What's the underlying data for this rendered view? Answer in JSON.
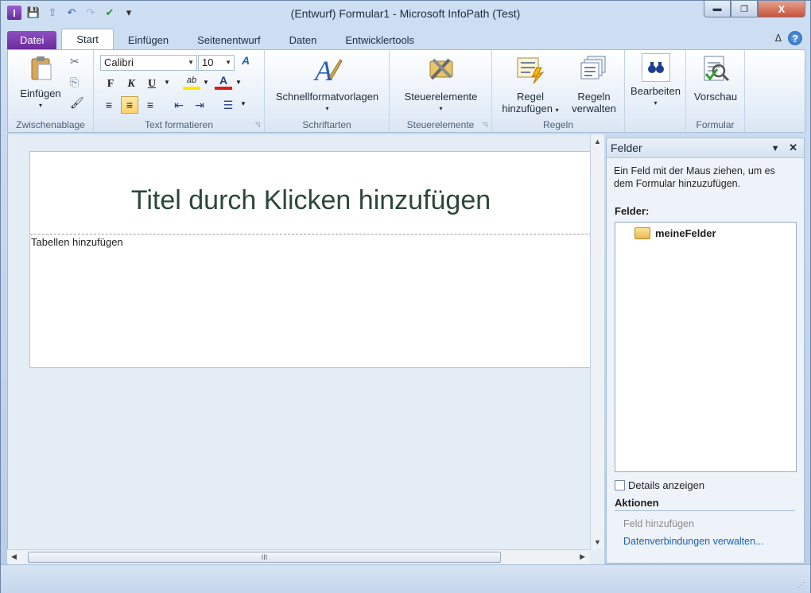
{
  "window": {
    "title": "(Entwurf) Formular1  -  Microsoft InfoPath (Test)",
    "min_glyph": "▬",
    "max_glyph": "❐",
    "close_glyph": "X"
  },
  "qat": {
    "app_glyph": "I",
    "save_glyph": "💾",
    "preview_glyph": "⇧",
    "undo_glyph": "↶",
    "redo_glyph": "↷",
    "check_glyph": "✔",
    "customize_glyph": "▾"
  },
  "tabs": {
    "file": "Datei",
    "start": "Start",
    "insert": "Einfügen",
    "page_design": "Seitenentwurf",
    "data": "Daten",
    "developer": "Entwicklertools",
    "collapse_glyph": "ᐃ",
    "help_glyph": "?"
  },
  "ribbon": {
    "clipboard": {
      "group_label": "Zwischenablage",
      "paste_label": "Einfügen",
      "cut_glyph": "✂",
      "copy_glyph": "⎘",
      "painter_glyph": "🖌"
    },
    "font": {
      "group_label": "Text formatieren",
      "font_name": "Calibri",
      "font_size": "10",
      "clear_glyph": "A",
      "bold": "F",
      "italic": "K",
      "underline": "U",
      "highlight_glyph": "ab",
      "font_color_glyph": "A",
      "align_left_glyph": "≡",
      "align_center_glyph": "≡",
      "align_right_glyph": "≡",
      "outdent_glyph": "⇤",
      "indent_glyph": "⇥",
      "bullets_glyph": "☰"
    },
    "styles": {
      "group_label": "Schriftarten",
      "quickstyles_label": "Schnellformatvorlagen"
    },
    "controls": {
      "group_label": "Steuerelemente",
      "controls_label": "Steuerelemente"
    },
    "rules": {
      "group_label": "Regeln",
      "add_rule_line1": "Regel",
      "add_rule_line2": "hinzufügen",
      "manage_rules_line1": "Regeln",
      "manage_rules_line2": "verwalten"
    },
    "editing": {
      "edit_label": "Bearbeiten"
    },
    "form": {
      "group_label": "Formular",
      "preview_label": "Vorschau"
    }
  },
  "form": {
    "title_placeholder": "Titel durch Klicken hinzufügen",
    "table_hint": "Tabellen hinzufügen"
  },
  "scroll": {
    "thumb_glyph": "III"
  },
  "taskpane": {
    "title": "Felder",
    "menu_glyph": "▼",
    "close_glyph": "✕",
    "description": "Ein Feld mit der Maus ziehen, um es dem Formular hinzuzufügen.",
    "fields_label": "Felder:",
    "root_group": "meineFelder",
    "show_details_label": "Details anzeigen",
    "actions_label": "Aktionen",
    "add_field_link": "Feld hinzufügen",
    "manage_connections_link": "Datenverbindungen verwalten..."
  }
}
